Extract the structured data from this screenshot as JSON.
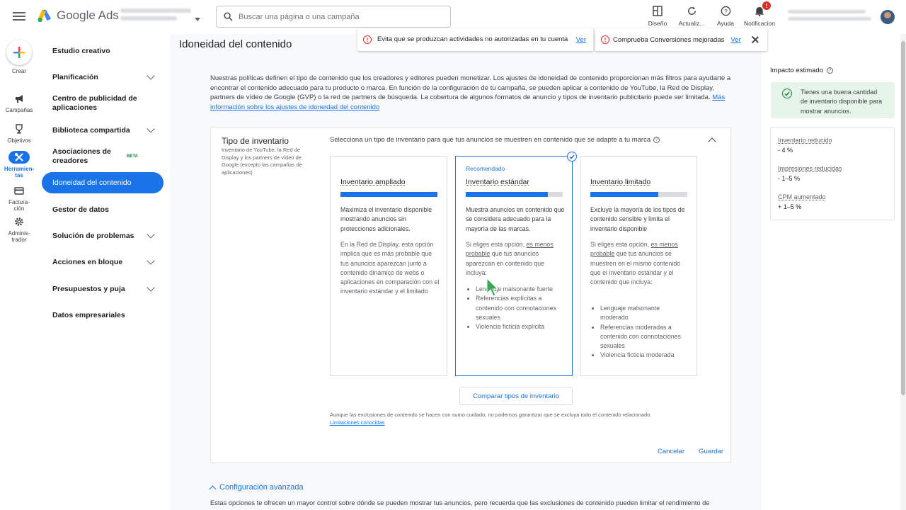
{
  "header": {
    "brand": "Google Ads",
    "search_placeholder": "Buscar una página o una campaña",
    "icons": [
      {
        "name": "design-icon",
        "label": "Diseño"
      },
      {
        "name": "refresh-icon",
        "label": "Actualiz..."
      },
      {
        "name": "help-icon",
        "label": "Ayuda"
      },
      {
        "name": "bell-icon",
        "label": "Notificacion",
        "badge": "!"
      }
    ]
  },
  "rail": {
    "create": "Crear",
    "items": [
      {
        "name": "campaigns",
        "label": "Campañas"
      },
      {
        "name": "goals",
        "label": "Objetivos"
      },
      {
        "name": "tools",
        "label": "Herramien-\ntas"
      },
      {
        "name": "billing",
        "label": "Factura-\nción"
      },
      {
        "name": "admin",
        "label": "Adminis-\ntrador"
      }
    ]
  },
  "sidenav": {
    "items": [
      {
        "label": "Estudio creativo"
      },
      {
        "label": "Planificación"
      },
      {
        "label": "Centro de publicidad de aplicaciones"
      },
      {
        "label": "Biblioteca compartida"
      },
      {
        "label": "Asociaciones de creadores",
        "badge": "BETA"
      },
      {
        "label": "Idoneidad del contenido"
      },
      {
        "label": "Gestor de datos"
      },
      {
        "label": "Solución de problemas"
      },
      {
        "label": "Acciones en bloque"
      },
      {
        "label": "Presupuestos y puja"
      },
      {
        "label": "Datos empresariales"
      }
    ]
  },
  "alerts": [
    {
      "text": "Evita que se produzcan actividades no autorizadas en tu cuenta",
      "link": "Ver"
    },
    {
      "text": "Comprueba Conversiones mejoradas",
      "link": "Ver"
    }
  ],
  "main": {
    "title": "Idoneidad del contenido",
    "intro": "Nuestras políticas definen el tipo de contenido que los creadores y editores pueden monetizar. Los ajustes de idoneidad de contenido proporcionan más filtros para ayudarte a encontrar el contenido adecuado para tu producto o marca. En función de la configuración de tu campaña, se pueden aplicar a contenido de YouTube, la Red de Display, partners de vídeo de Google (GVP) o la red de partners de búsqueda. La cobertura de algunos formatos de anuncio y tipos de inventario publicitario puede ser limitada.",
    "intro_link": "Más información sobre los ajustes de idoneidad del contenido",
    "inventory": {
      "title": "Tipo de inventario",
      "desc": "Inventario de YouTube, la Red de Display y los partners de vídeo de Google (excepto las campañas de aplicaciones)",
      "select_label": "Selecciona un tipo de inventario para que tus anuncios se muestren en contenido que se adapte a tu marca",
      "options": [
        {
          "title": "Inventario ampliado",
          "level": 1.0,
          "p1": "Maximiza el inventario disponible mostrando anuncios sin protecciones adicionales.",
          "p2": "En la Red de Display, esta opción implica que es más probable que tus anuncios aparezcan junto a contenido dinámico de webs o aplicaciones en comparación con el inventario estándar y el limitado"
        },
        {
          "recommended": "Recomendado",
          "title": "Inventario estándar",
          "level": 0.85,
          "p1": "Muestra anuncios en contenido que se considera adecuado para la mayoría de las marcas.",
          "p2a": "Si eliges esta opción, ",
          "p2u": "es menos probable",
          "p2b": " que tus anuncios aparezcan en contenido que incluya:",
          "bullets": [
            "Lenguaje malsonante fuerte",
            "Referencias explícitas a contenido con connotaciones sexuales",
            "Violencia ficticia explícita"
          ]
        },
        {
          "title": "Inventario limitado",
          "level": 0.7,
          "p1": "Excluye la mayoría de los tipos de contenido sensible y limita el inventario disponible",
          "p2a": "Si eliges esta opción, ",
          "p2u": "es menos probable",
          "p2b": " que tus anuncios se muestren en el mismo contenido que el inventario estándar y el contenido que incluya:",
          "bullets": [
            "Lenguaje malsonante moderado",
            "Referencias moderadas a contenido con connotaciones sexuales",
            "Violencia ficticia moderada"
          ]
        }
      ],
      "compare_btn": "Comparar tipos de inventario",
      "disclaimer": "Aunque las exclusiones de contenido se hacen con sumo cuidado, no podemos garantizar que se excluya todo el contenido relacionado.",
      "disclaimer_link": "Limitaciones conocidas",
      "cancel": "Cancelar",
      "save": "Guardar"
    },
    "advanced": {
      "title": "Configuración avanzada",
      "desc": "Estas opciones te ofrecen un mayor control sobre dónde se pueden mostrar tus anuncios, pero recuerda que las exclusiones de contenido pueden limitar el rendimiento de"
    }
  },
  "impact": {
    "title": "Impacto estimado",
    "good": "Tienes una buena cantidad de inventario disponible para mostrar anuncios.",
    "stats": [
      {
        "label": "Inventario reducido",
        "value": "- 4 %"
      },
      {
        "label": "Impresiones reducidas",
        "value": "- 1–5 %"
      },
      {
        "label": "CPM aumentado",
        "value": "+ 1–5 %"
      }
    ]
  },
  "colors": {
    "accent": "#1a73e8",
    "error": "#d93025",
    "success": "#188038"
  }
}
